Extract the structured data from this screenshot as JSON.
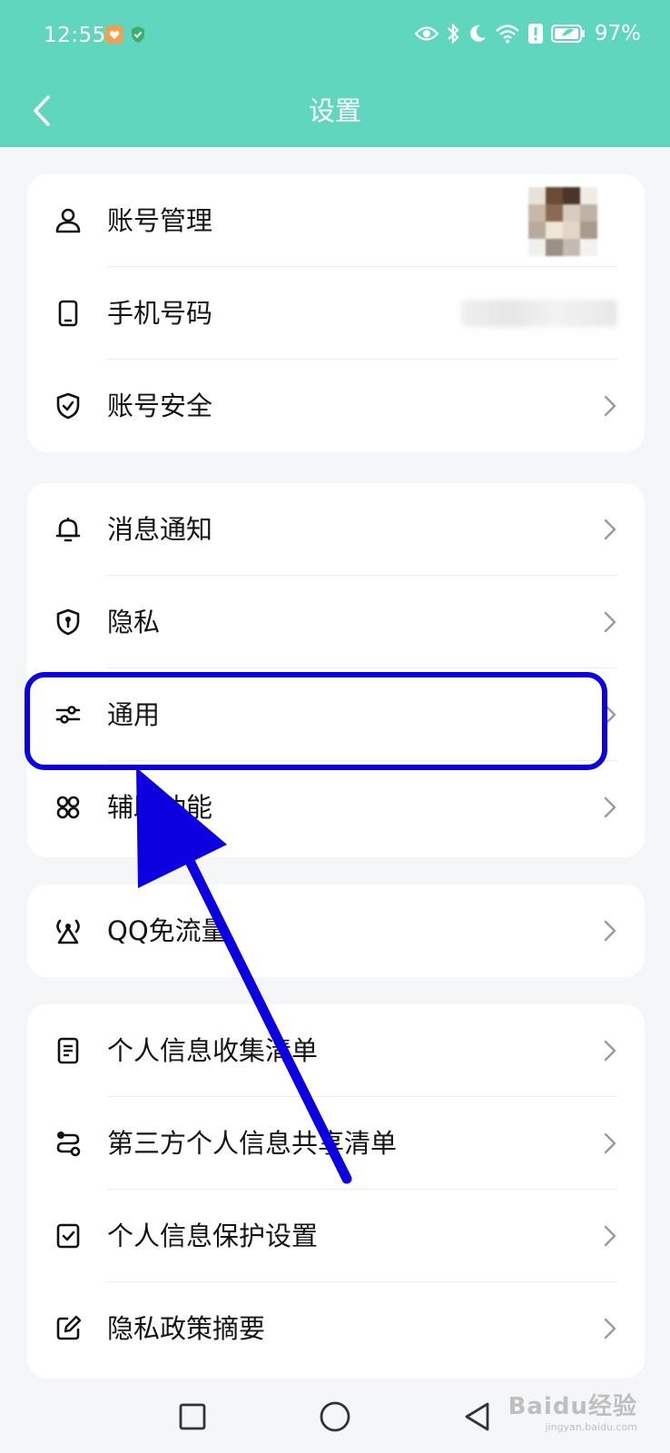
{
  "status_bar": {
    "time": "12:55",
    "battery_percent": "97%"
  },
  "header": {
    "title": "设置",
    "back_icon": "chevron-left-icon"
  },
  "groups": [
    {
      "items": [
        {
          "label": "账号管理",
          "icon": "person-icon",
          "accessory": "avatar"
        },
        {
          "label": "手机号码",
          "icon": "phone-icon",
          "accessory": "blurred-value"
        },
        {
          "label": "账号安全",
          "icon": "shield-check-icon",
          "accessory": "chevron"
        }
      ]
    },
    {
      "items": [
        {
          "label": "消息通知",
          "icon": "bell-icon",
          "accessory": "chevron"
        },
        {
          "label": "隐私",
          "icon": "privacy-shield-icon",
          "accessory": "chevron"
        },
        {
          "label": "通用",
          "icon": "sliders-icon",
          "accessory": "chevron"
        },
        {
          "label": "辅助功能",
          "icon": "command-icon",
          "accessory": "chevron"
        }
      ]
    },
    {
      "items": [
        {
          "label": "QQ免流量",
          "icon": "antenna-icon",
          "accessory": "chevron"
        }
      ]
    },
    {
      "items": [
        {
          "label": "个人信息收集清单",
          "icon": "document-icon",
          "accessory": "chevron"
        },
        {
          "label": "第三方个人信息共享清单",
          "icon": "share-route-icon",
          "accessory": "chevron"
        },
        {
          "label": "个人信息保护设置",
          "icon": "checkbox-doc-icon",
          "accessory": "chevron"
        },
        {
          "label": "隐私政策摘要",
          "icon": "edit-icon",
          "accessory": "chevron"
        }
      ]
    }
  ],
  "annotation": {
    "highlighted_item": "通用",
    "color": "#0d00e0"
  },
  "colors": {
    "header_bg": "#5fd6bd",
    "page_bg": "#f5f6f8"
  },
  "watermark": {
    "main": "Baidu经验",
    "sub": "jingyan.baidu.com"
  }
}
